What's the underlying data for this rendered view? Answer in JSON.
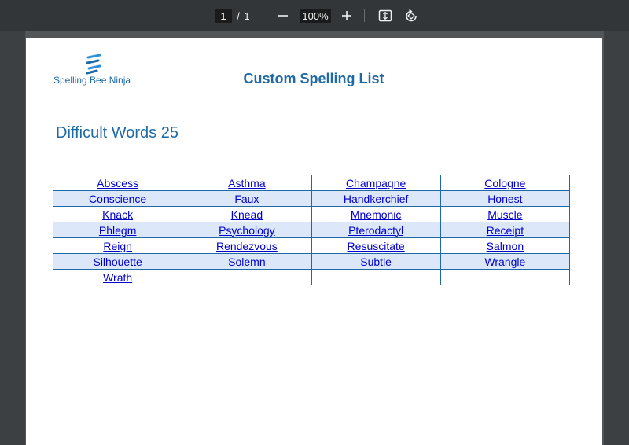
{
  "viewer": {
    "current_page": "1",
    "separator": "/",
    "total_pages": "1",
    "zoom": "100%",
    "icons": [
      "minus-icon",
      "plus-icon",
      "fit-page-icon",
      "rotate-icon"
    ]
  },
  "document": {
    "logo_text": "Spelling Bee Ninja",
    "title": "Custom Spelling List",
    "list_name": "Difficult Words 25",
    "colors": {
      "accent": "#1e6aa6",
      "link": "#0000cc",
      "row_alt": "#dce8f9"
    },
    "rows": [
      [
        "Abscess",
        "Asthma",
        "Champagne",
        "Cologne"
      ],
      [
        "Conscience",
        "Faux",
        "Handkerchief",
        "Honest"
      ],
      [
        "Knack",
        "Knead",
        "Mnemonic",
        "Muscle"
      ],
      [
        "Phlegm",
        "Psychology",
        "Pterodactyl",
        "Receipt"
      ],
      [
        "Reign",
        "Rendezvous",
        "Resuscitate",
        "Salmon"
      ],
      [
        "Silhouette",
        "Solemn",
        "Subtle",
        "Wrangle"
      ],
      [
        "Wrath",
        "",
        "",
        ""
      ]
    ]
  }
}
